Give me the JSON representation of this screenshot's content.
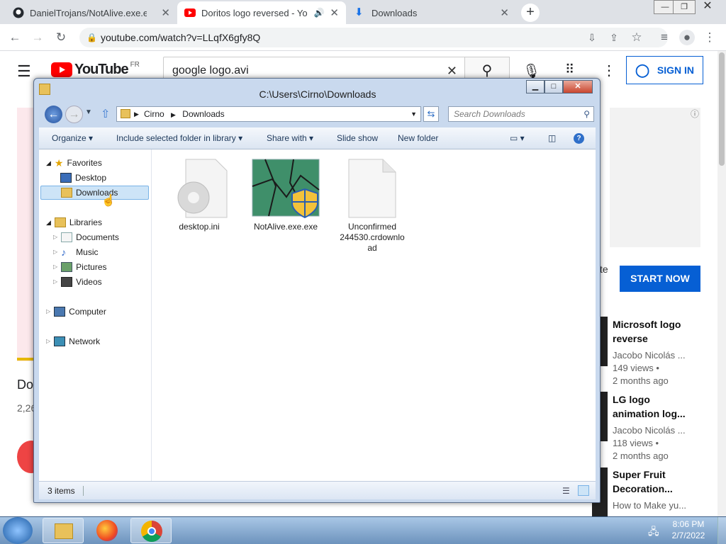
{
  "browser": {
    "tabs": [
      {
        "title": "DanielTrojans/NotAlive.exe.exe a"
      },
      {
        "title": "Doritos logo reversed - YouT"
      },
      {
        "title": "Downloads"
      }
    ],
    "url": "youtube.com/watch?v=LLqfX6gfy8Q",
    "new_tab": "+"
  },
  "youtube": {
    "logo": "YouTube",
    "region": "FR",
    "search_query": "google logo.avi",
    "sign_in": "SIGN IN",
    "start_now": "START NOW",
    "partial_text": "te",
    "video_title_partial": "Do",
    "views_partial": "2,26",
    "recommendations": [
      {
        "title1": "Microsoft logo",
        "title2": "reverse",
        "channel": "Jacobo Nicolás ...",
        "views": "149 views •",
        "age": "2 months ago"
      },
      {
        "title1": "LG logo",
        "title2": "animation log...",
        "channel": "Jacobo Nicolás ...",
        "views": "118 views •",
        "age": "2 months ago"
      },
      {
        "title1": "Super Fruit",
        "title2": "Decoration...",
        "channel": "How to Make yu..."
      }
    ]
  },
  "explorer": {
    "title": "C:\\Users\\Cirno\\Downloads",
    "breadcrumb": [
      "Cirno",
      "Downloads"
    ],
    "search_placeholder": "Search Downloads",
    "commands": [
      "Organize",
      "Include selected folder in library",
      "Share with",
      "Slide show",
      "New folder"
    ],
    "nav": {
      "favorites": "Favorites",
      "desktop": "Desktop",
      "downloads": "Downloads",
      "libraries": "Libraries",
      "documents": "Documents",
      "music": "Music",
      "pictures": "Pictures",
      "videos": "Videos",
      "computer": "Computer",
      "network": "Network"
    },
    "files": [
      {
        "name": "desktop.ini"
      },
      {
        "name": "NotAlive.exe.exe"
      },
      {
        "name1": "Unconfirmed",
        "name2": "244530.crdownlo",
        "name3": "ad"
      }
    ],
    "status": "3 items"
  },
  "taskbar": {
    "time": "8:06 PM",
    "date": "2/7/2022"
  }
}
